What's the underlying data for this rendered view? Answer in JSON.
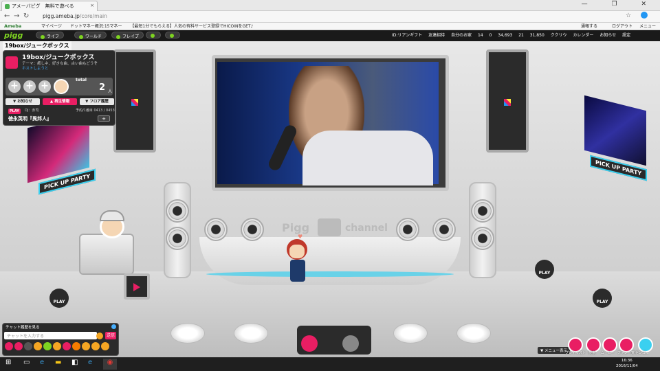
{
  "browser": {
    "tab_title": "アメーバピグ　無料で遊べる",
    "url_host": "pigg.ameba.jp",
    "url_path": "/core/main",
    "bookmarks": [
      "マイページ",
      "ドットマネー概況:15マネー",
      "【最短1分でもらえる】人気の有料サービス登録でHICOINをGET♪"
    ],
    "bookmark_right": [
      "通報する",
      "ログアウト",
      "メニュー"
    ]
  },
  "pigg_header": {
    "brand": "Ameba",
    "logo": "pigg",
    "nav": [
      "ライフ",
      "ワールド",
      "フレイプ"
    ],
    "right_items": [
      "ID:リアンギフト",
      "友達招待",
      "自分のお家",
      "14",
      "0",
      "34,693",
      "21",
      "31,850",
      "ククリウ",
      "カレンダー",
      "お知らせ",
      "設定"
    ]
  },
  "room": {
    "label": "19box/ジュークボックス",
    "title": "19box/ジュークボックス",
    "theme": "テーマ：癒しネ、好きな曲、古い曲もどうぞ",
    "follow": "ホストしようと",
    "total_label": "total",
    "total_value": "2",
    "total_unit": "人",
    "tabs": [
      "▼ お知らせ",
      "▲ 再生情報",
      "▼ フロア履歴"
    ],
    "play_badge": "PLAY",
    "dj_label": "DJ：赤司",
    "reserve": "予約/1番目 0413 / 0453",
    "song": "徳永英明『異邦人』",
    "song_add": "+"
  },
  "stage": {
    "brand_left": "Pigg",
    "brand_right": "channel",
    "pickup": "PICK UP PARTY",
    "play": "PLAY"
  },
  "chat": {
    "history": "チャット履歴を見る",
    "placeholder": "チャットを入力する",
    "send": "送信"
  },
  "bottom_right": {
    "menu_show": "▼ メニュー表示",
    "buttons": [
      "プレイリスト",
      "検索",
      "ムービー",
      "ファン一覧",
      "ゼンゴ..."
    ]
  },
  "taskbar": {
    "time": "16:36",
    "date": "2016/11/04"
  },
  "colors": {
    "accent": "#e91e63",
    "glow": "#3ad0f0",
    "header": "#1a1a1a"
  }
}
